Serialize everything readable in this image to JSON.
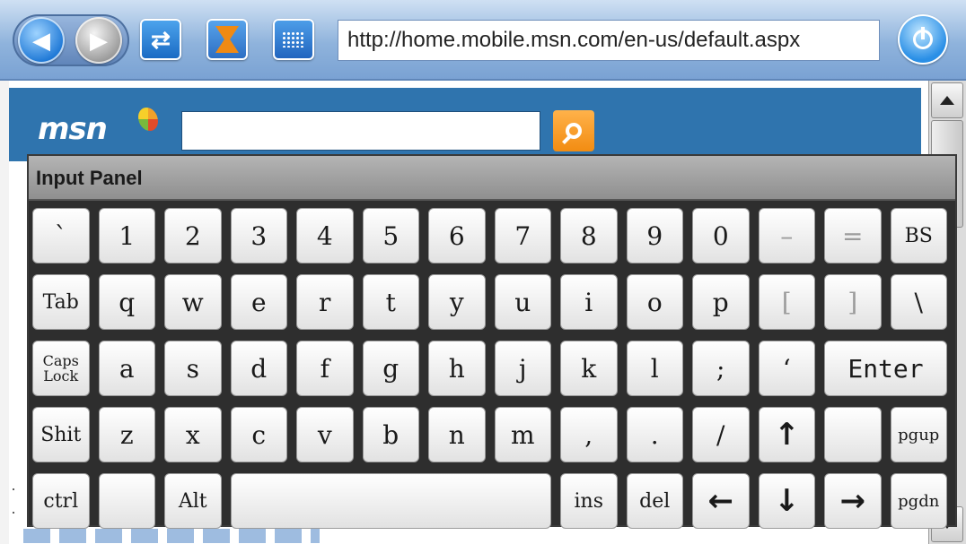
{
  "browser": {
    "url": "http://home.mobile.msn.com/en-us/default.aspx",
    "icons": {
      "back": "back-arrow-icon",
      "forward": "forward-arrow-icon",
      "refresh": "refresh-icon",
      "stop": "stop-x-icon",
      "keyboard": "keyboard-grid-icon",
      "power": "power-icon"
    }
  },
  "page": {
    "brand": "msn",
    "search_value": "",
    "colors": {
      "header": "#2f74ae",
      "search_button": "#f28c12"
    }
  },
  "input_panel": {
    "title": "Input Panel",
    "rows": [
      [
        "`",
        "1",
        "2",
        "3",
        "4",
        "5",
        "6",
        "7",
        "8",
        "9",
        "0",
        "–",
        "=",
        "BS"
      ],
      [
        "Tab",
        "q",
        "w",
        "e",
        "r",
        "t",
        "y",
        "u",
        "i",
        "o",
        "p",
        "[",
        "]",
        "\\"
      ],
      [
        "Caps Lock",
        "a",
        "s",
        "d",
        "f",
        "g",
        "h",
        "j",
        "k",
        "l",
        ";",
        "‘",
        "Enter"
      ],
      [
        "Shit",
        "z",
        "x",
        "c",
        "v",
        "b",
        "n",
        "m",
        ",",
        ".",
        "/",
        "↑",
        "",
        "pgup"
      ],
      [
        "ctrl",
        "",
        "Alt",
        "",
        "ins",
        "del",
        "←",
        "↓",
        "→",
        "pgdn"
      ]
    ]
  }
}
